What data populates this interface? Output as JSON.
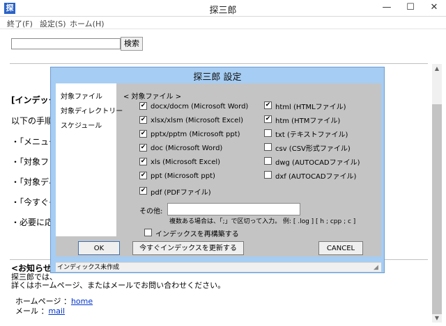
{
  "window": {
    "icon_char": "探",
    "title": "探三郎",
    "min": "—",
    "max": "☐",
    "close": "✕"
  },
  "menu": [
    {
      "label": "終了(F)"
    },
    {
      "label": "設定(S)"
    },
    {
      "label": "ホーム(H)"
    }
  ],
  "search": {
    "value": "",
    "button": "検索"
  },
  "body": {
    "line0": "[インデック",
    "line1": "以下の手順",
    "line2": "・「メニュー",
    "line3": "・「対象ファ",
    "line4": "・「対象ディ",
    "line5": "・「今すぐイ",
    "line6": "・必要に応",
    "notice_title": "<お知らせ>",
    "notice_line1": "探三郎では、",
    "notice_line2": "詳くはホームページ、またはメールでお問い合わせください。",
    "homepage_label": "ホームページ  ：",
    "homepage_link": "home",
    "mail_label": "メール  ：",
    "mail_link": "mail"
  },
  "dialog": {
    "title": "探三郎  設定",
    "nav": [
      "対象ファイル",
      "対象ディレクトリー",
      "スケジュール"
    ],
    "group_label": "< 対象ファイル >",
    "left_checks": [
      {
        "label": "docx/docm (Microsoft Word)",
        "checked": true
      },
      {
        "label": "xlsx/xlsm (Microsoft Excel)",
        "checked": true
      },
      {
        "label": "pptx/pptm (Microsoft ppt)",
        "checked": true
      },
      {
        "label": "doc (Microsoft Word)",
        "checked": true
      },
      {
        "label": "xls (Microsoft Excel)",
        "checked": true
      },
      {
        "label": "ppt (Microsoft ppt)",
        "checked": true
      },
      {
        "label": "pdf (PDFファイル)",
        "checked": true
      }
    ],
    "right_checks": [
      {
        "label": "html (HTMLファイル)",
        "checked": true
      },
      {
        "label": "htm (HTMファイル)",
        "checked": true
      },
      {
        "label": "txt (テキストファイル)",
        "checked": false
      },
      {
        "label": "csv (CSV形式ファイル)",
        "checked": false
      },
      {
        "label": "dwg (AUTOCADファイル)",
        "checked": false
      },
      {
        "label": "dxf (AUTOCADファイル)",
        "checked": false
      }
    ],
    "other_label": "その他:",
    "other_value": "",
    "hint": "複数ある場合は、「;」で区切って入力。 例: [ .log ] [ h ; cpp ; c ]",
    "rebuild_label": "インデックスを再構築する",
    "rebuild_checked": false,
    "ok": "OK",
    "update_now": "今すぐインデックスを更新する",
    "cancel": "CANCEL",
    "status": "インディックス未作成"
  }
}
